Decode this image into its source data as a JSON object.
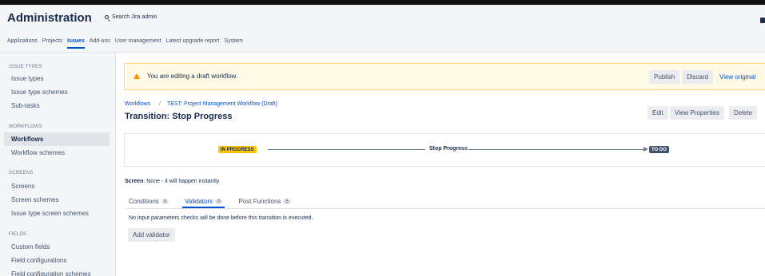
{
  "header": {
    "title": "Administration",
    "search_placeholder": "Search Jira admin"
  },
  "nav": {
    "tabs": [
      {
        "label": "Applications"
      },
      {
        "label": "Projects"
      },
      {
        "label": "Issues",
        "active": true
      },
      {
        "label": "Add-ons"
      },
      {
        "label": "User management"
      },
      {
        "label": "Latest upgrade report"
      },
      {
        "label": "System"
      }
    ]
  },
  "sidebar": {
    "sections": [
      {
        "heading": "ISSUE TYPES",
        "items": [
          "Issue types",
          "Issue type schemes",
          "Sub-tasks"
        ]
      },
      {
        "heading": "WORKFLOWS",
        "items": [
          "Workflows",
          "Workflow schemes"
        ]
      },
      {
        "heading": "SCREENS",
        "items": [
          "Screens",
          "Screen schemes",
          "Issue type screen schemes"
        ]
      },
      {
        "heading": "FIELDS",
        "items": [
          "Custom fields",
          "Field configurations",
          "Field configuration schemes"
        ]
      }
    ],
    "selected": "Workflows"
  },
  "banner": {
    "message": "You are editing a draft workflow.",
    "publish_label": "Publish",
    "discard_label": "Discard",
    "view_original_label": "View original"
  },
  "breadcrumb": {
    "root": "Workflows",
    "separator": "/",
    "current": "TEST: Project Management Workflow (Draft)"
  },
  "page": {
    "title": "Transition: Stop Progress",
    "edit_label": "Edit",
    "view_properties_label": "View Properties",
    "delete_label": "Delete"
  },
  "diagram": {
    "from_status": "IN PROGRESS",
    "transition": "Stop Progress",
    "to_status": "TO DO"
  },
  "screen": {
    "label": "Screen",
    "value": ": None - it will happen instantly"
  },
  "subtabs": [
    {
      "label": "Conditions",
      "count": "0"
    },
    {
      "label": "Validators",
      "count": "0",
      "active": true
    },
    {
      "label": "Post Functions",
      "count": "5"
    }
  ],
  "validators": {
    "empty_message": "No input parameters checks will be done before this transition is executed.",
    "add_label": "Add validator"
  },
  "colors": {
    "accent": "#0052cc",
    "in_progress": "#ffc400",
    "to_do": "#42526e",
    "warning": "#ff8b00"
  }
}
